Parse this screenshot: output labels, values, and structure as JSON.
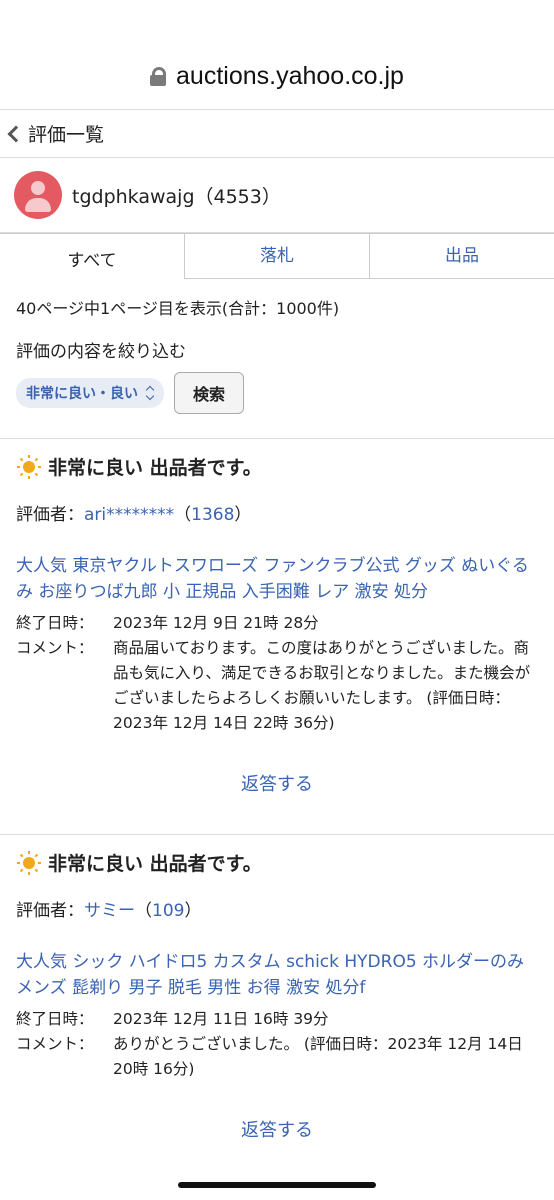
{
  "browser": {
    "url": "auctions.yahoo.co.jp"
  },
  "header": {
    "title": "評価一覧"
  },
  "profile": {
    "name": "tgdphkawajg（4553）"
  },
  "tabs": [
    {
      "label": "すべて",
      "active": true
    },
    {
      "label": "落札",
      "active": false
    },
    {
      "label": "出品",
      "active": false
    }
  ],
  "summary": "40ページ中1ページ目を表示(合計：1000件)",
  "filter": {
    "label": "評価の内容を絞り込む",
    "selected": "非常に良い・良い",
    "search_label": "検索"
  },
  "reviews": [
    {
      "rating": "非常に良い 出品者です。",
      "rater_prefix": "評価者：",
      "rater_name": "ari********",
      "rater_open": "（",
      "rater_score": "1368",
      "rater_close": "）",
      "item_title": "大人気 東京ヤクルトスワローズ ファンクラブ公式 グッズ ぬいぐるみ お座りつば九郎 小 正規品 入手困難 レア 激安 処分",
      "end_key": "終了日時：",
      "end_val": "2023年 12月 9日 21時 28分",
      "comment_key": "コメント：",
      "comment_val": "商品届いております。この度はありがとうございました。商品も気に入り、満足できるお取引となりました。また機会がございましたらよろしくお願いいたします。 (評価日時：2023年 12月 14日 22時 36分)",
      "reply": "返答する"
    },
    {
      "rating": "非常に良い 出品者です。",
      "rater_prefix": "評価者：",
      "rater_name": "サミー",
      "rater_open": "（",
      "rater_score": "109",
      "rater_close": "）",
      "item_title": "大人気 シック ハイドロ5 カスタム schick HYDRO5 ホルダーのみ メンズ 髭剃り 男子 脱毛 男性 お得 激安 処分f",
      "end_key": "終了日時：",
      "end_val": "2023年 12月 11日 16時 39分",
      "comment_key": "コメント：",
      "comment_val": "ありがとうございました。 (評価日時：2023年 12月 14日 20時 16分)",
      "reply": "返答する"
    }
  ]
}
